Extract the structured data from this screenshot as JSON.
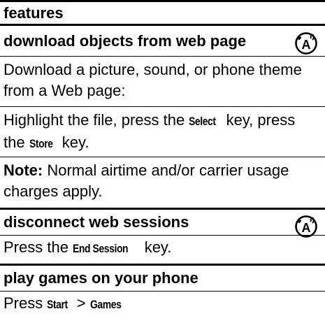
{
  "header": {
    "title": "features"
  },
  "sections": [
    {
      "title": "download objects from web page",
      "icon": "network-service-icon",
      "paragraphs": [
        {
          "text": "Download a picture, sound, or phone theme from a Web page:"
        },
        {
          "text_before_select": "Highlight the file, press the ",
          "select_key": "Select",
          "text_middle": " key, press the ",
          "store_key": "Store",
          "text_after": " key."
        },
        {
          "note_label": "Note:",
          "note_text": " Normal airtime and/or carrier usage charges apply."
        }
      ]
    },
    {
      "title": "disconnect web sessions",
      "icon": "network-service-icon",
      "paragraphs": [
        {
          "text_before": "Press the ",
          "key": "End Session",
          "text_after": " key."
        }
      ]
    },
    {
      "title": "play games on your phone",
      "paragraphs": [
        {
          "text_before": "Press ",
          "key1": "Start",
          "separator": " > ",
          "key2": "Games"
        }
      ]
    }
  ]
}
